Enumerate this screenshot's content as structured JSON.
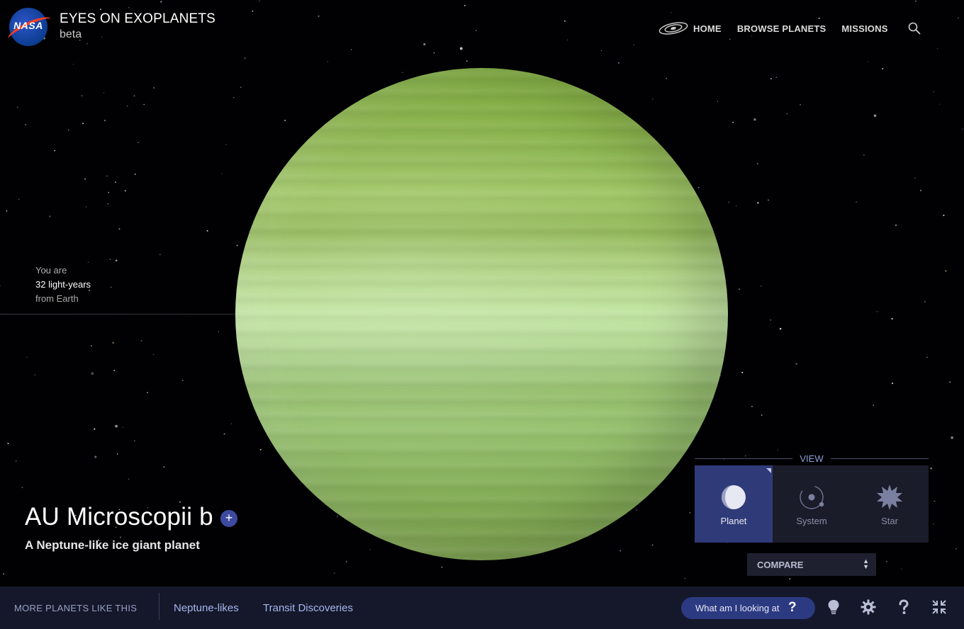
{
  "header": {
    "logo_text": "NASA",
    "app_title": "EYES ON EXOPLANETS",
    "app_subtitle": "beta",
    "nav": [
      "HOME",
      "BROWSE PLANETS",
      "MISSIONS"
    ],
    "icons": {
      "galaxy": "galaxy-icon",
      "search": "search-icon"
    }
  },
  "distance": {
    "line1": "You are",
    "line2": "32 light-years",
    "line3": "from Earth"
  },
  "planet": {
    "name": "AU Microscopii b",
    "add_symbol": "+",
    "description": "A Neptune-like ice giant planet"
  },
  "view_panel": {
    "label": "VIEW",
    "options": [
      "Planet",
      "System",
      "Star"
    ],
    "selected": "Planet",
    "compare_label": "COMPARE",
    "compare_arrows": [
      "▲",
      "▼"
    ]
  },
  "bottom_bar": {
    "more_label": "MORE PLANETS LIKE THIS",
    "tags": [
      "Neptune-likes",
      "Transit Discoveries"
    ],
    "what_label": "What am I looking at",
    "what_symbol": "?",
    "icons": [
      "lightbulb-icon",
      "gear-icon",
      "help-icon",
      "fullscreen-icon"
    ]
  },
  "colors": {
    "accent": "#2f3a78",
    "bar_background": "#15182a",
    "link": "#a7b6ee",
    "planet_tint": "#a7cd86"
  }
}
